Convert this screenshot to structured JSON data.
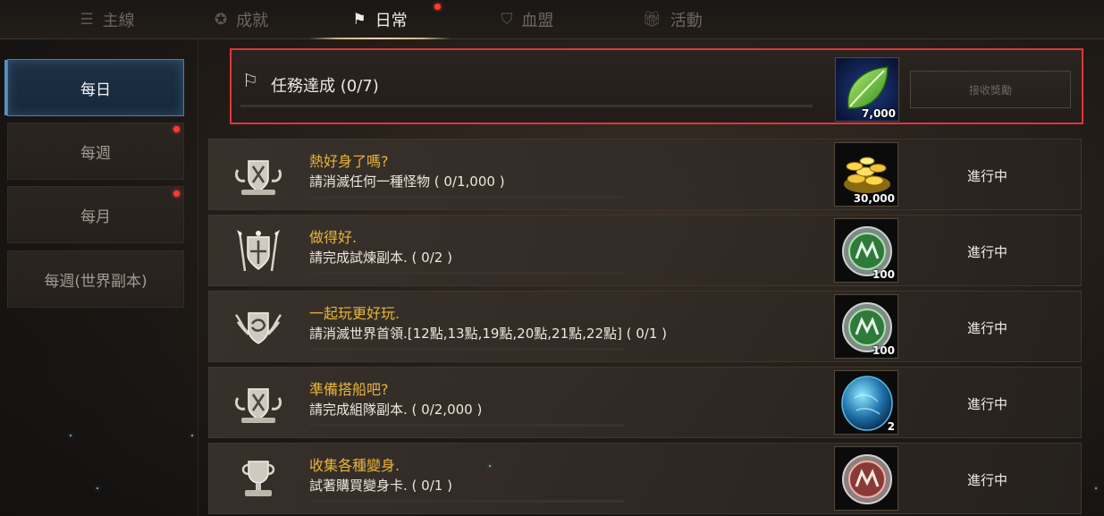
{
  "tabs": [
    {
      "label": "主線",
      "icon": "list-icon"
    },
    {
      "label": "成就",
      "icon": "medal-icon"
    },
    {
      "label": "日常",
      "icon": "flag-icon",
      "active": true
    },
    {
      "label": "血盟",
      "icon": "shield-icon"
    },
    {
      "label": "活動",
      "icon": "gift-icon"
    }
  ],
  "sidebar": {
    "items": [
      {
        "label": "每日",
        "active": true
      },
      {
        "label": "每週",
        "badge": true
      },
      {
        "label": "每月",
        "badge": true
      },
      {
        "label": "每週(世界副本)"
      }
    ]
  },
  "header": {
    "title": "任務達成 (0/7)",
    "reward_icon": "leaf-icon",
    "reward_qty": "7,000",
    "claim_label": "接收獎勵"
  },
  "quests": [
    {
      "name": "熱好身了嗎?",
      "desc": "請消滅任何一種怪物 ( 0/1,000 )",
      "reward_icon": "gold-coins-icon",
      "reward_qty": "30,000",
      "status": "進行中",
      "emblem": "shield-swords-emblem"
    },
    {
      "name": "做得好.",
      "desc": "請完成試煉副本. ( 0/2 )",
      "reward_icon": "green-coin-icon",
      "reward_qty": "100",
      "status": "進行中",
      "emblem": "spear-shield-emblem"
    },
    {
      "name": "一起玩更好玩.",
      "desc": "請消滅世界首領.[12點,13點,19點,20點,21點,22點] ( 0/1 )",
      "reward_icon": "green-coin-icon",
      "reward_qty": "100",
      "status": "進行中",
      "emblem": "winged-crest-emblem"
    },
    {
      "name": "準備搭船吧?",
      "desc": "請完成組隊副本. ( 0/2,000 )",
      "reward_icon": "blue-gem-icon",
      "reward_qty": "2",
      "status": "進行中",
      "emblem": "shield-swords-emblem"
    },
    {
      "name": "收集各種變身.",
      "desc": "試著購買變身卡. ( 0/1 )",
      "reward_icon": "red-coin-icon",
      "reward_qty": "",
      "status": "進行中",
      "emblem": "trophy-emblem"
    }
  ],
  "colors": {
    "accent_gold": "#e8b43a",
    "highlight_red": "#e0363a",
    "active_blue": "#4f7ea6",
    "badge_red": "#ff3b2f"
  }
}
